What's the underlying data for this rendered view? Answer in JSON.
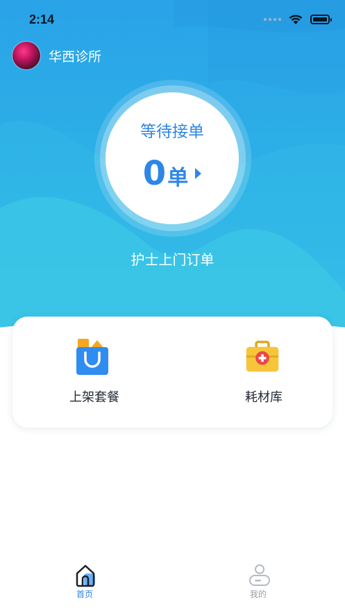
{
  "status_bar": {
    "time": "2:14"
  },
  "clinic": {
    "name": "华西诊所"
  },
  "order_status": {
    "wait_label": "等待接单",
    "count": "0",
    "unit": "单"
  },
  "order_type_label": "护士上门订单",
  "actions": [
    {
      "label": "上架套餐",
      "icon": "shopping-bag-icon"
    },
    {
      "label": "耗材库",
      "icon": "medical-kit-icon"
    }
  ],
  "tabbar": {
    "home": {
      "label": "首页",
      "icon": "home-icon",
      "active": true
    },
    "mine": {
      "label": "我的",
      "icon": "profile-icon",
      "active": false
    }
  },
  "colors": {
    "accent": "#2e86e6",
    "hero_top": "#2aa3e8",
    "hero_bottom": "#3cc7e6",
    "tab_inactive": "#9aa0a8"
  }
}
